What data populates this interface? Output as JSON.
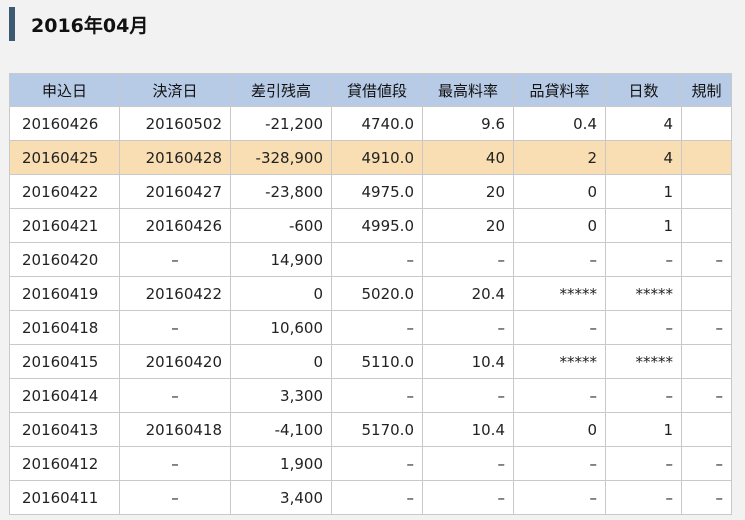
{
  "heading": {
    "title": "2016年04月"
  },
  "table": {
    "columns": [
      "申込日",
      "決済日",
      "差引残高",
      "貸借値段",
      "最高料率",
      "品貸料率",
      "日数",
      "規制"
    ],
    "highlight_color": "#f8deb2",
    "rows": [
      {
        "cells": [
          "20160426",
          "20160502",
          "-21,200",
          "4740.0",
          "9.6",
          "0.4",
          "4",
          ""
        ],
        "highlight": false
      },
      {
        "cells": [
          "20160425",
          "20160428",
          "-328,900",
          "4910.0",
          "40",
          "2",
          "4",
          ""
        ],
        "highlight": true
      },
      {
        "cells": [
          "20160422",
          "20160427",
          "-23,800",
          "4975.0",
          "20",
          "0",
          "1",
          ""
        ],
        "highlight": false
      },
      {
        "cells": [
          "20160421",
          "20160426",
          "-600",
          "4995.0",
          "20",
          "0",
          "1",
          ""
        ],
        "highlight": false
      },
      {
        "cells": [
          "20160420",
          "–",
          "14,900",
          "–",
          "–",
          "–",
          "–",
          "–"
        ],
        "highlight": false
      },
      {
        "cells": [
          "20160419",
          "20160422",
          "0",
          "5020.0",
          "20.4",
          "*****",
          "*****",
          ""
        ],
        "highlight": false
      },
      {
        "cells": [
          "20160418",
          "–",
          "10,600",
          "–",
          "–",
          "–",
          "–",
          "–"
        ],
        "highlight": false
      },
      {
        "cells": [
          "20160415",
          "20160420",
          "0",
          "5110.0",
          "10.4",
          "*****",
          "*****",
          ""
        ],
        "highlight": false
      },
      {
        "cells": [
          "20160414",
          "–",
          "3,300",
          "–",
          "–",
          "–",
          "–",
          "–"
        ],
        "highlight": false
      },
      {
        "cells": [
          "20160413",
          "20160418",
          "-4,100",
          "5170.0",
          "10.4",
          "0",
          "1",
          ""
        ],
        "highlight": false
      },
      {
        "cells": [
          "20160412",
          "–",
          "1,900",
          "–",
          "–",
          "–",
          "–",
          "–"
        ],
        "highlight": false
      },
      {
        "cells": [
          "20160411",
          "–",
          "3,400",
          "–",
          "–",
          "–",
          "–",
          "–"
        ],
        "highlight": false
      }
    ]
  }
}
